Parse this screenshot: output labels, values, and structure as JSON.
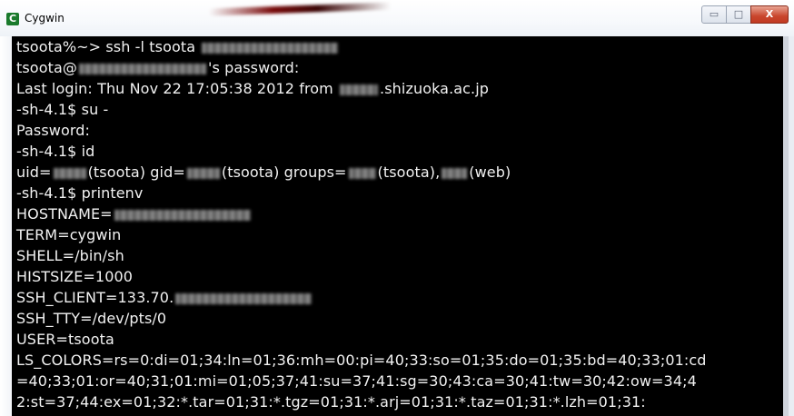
{
  "window": {
    "title": "Cygwin",
    "icon": "cygwin-app-icon",
    "controls": {
      "minimize_glyph": "▭",
      "maximize_glyph": "□",
      "close_glyph": "X"
    }
  },
  "terminal": {
    "lines": [
      "tsoota%~> ssh -l tsoota",
      "tsoota@",
      "'s password:",
      "Last login: Thu Nov 22 17:05:38 2012 from",
      ".shizuoka.ac.jp",
      "-sh-4.1$ su -",
      "Password:",
      "-sh-4.1$ id",
      "uid=",
      "(tsoota) gid=",
      "(tsoota) groups=",
      "(tsoota),",
      "(web)",
      "-sh-4.1$ printenv",
      "HOSTNAME=",
      "TERM=cygwin",
      "SHELL=/bin/sh",
      "HISTSIZE=1000",
      "SSH_CLIENT=133.70.",
      "SSH_TTY=/dev/pts/0",
      "USER=tsoota",
      "LS_COLORS=rs=0:di=01;34:ln=01;36:mh=00:pi=40;33:so=01;35:do=01;35:bd=40;33;01:cd",
      "=40;33;01:or=40;31;01:mi=01;05;37;41:su=37;41:sg=30;43:ca=30;41:tw=30;42:ow=34;4",
      "2:st=37;44:ex=01;32:*.tar=01;31:*.tgz=01;31:*.arj=01;31:*.taz=01;31:*.lzh=01;31:"
    ]
  },
  "colors": {
    "terminal_bg": "#000000",
    "terminal_fg": "#f2f2f2",
    "close_button": "#c9462d"
  }
}
